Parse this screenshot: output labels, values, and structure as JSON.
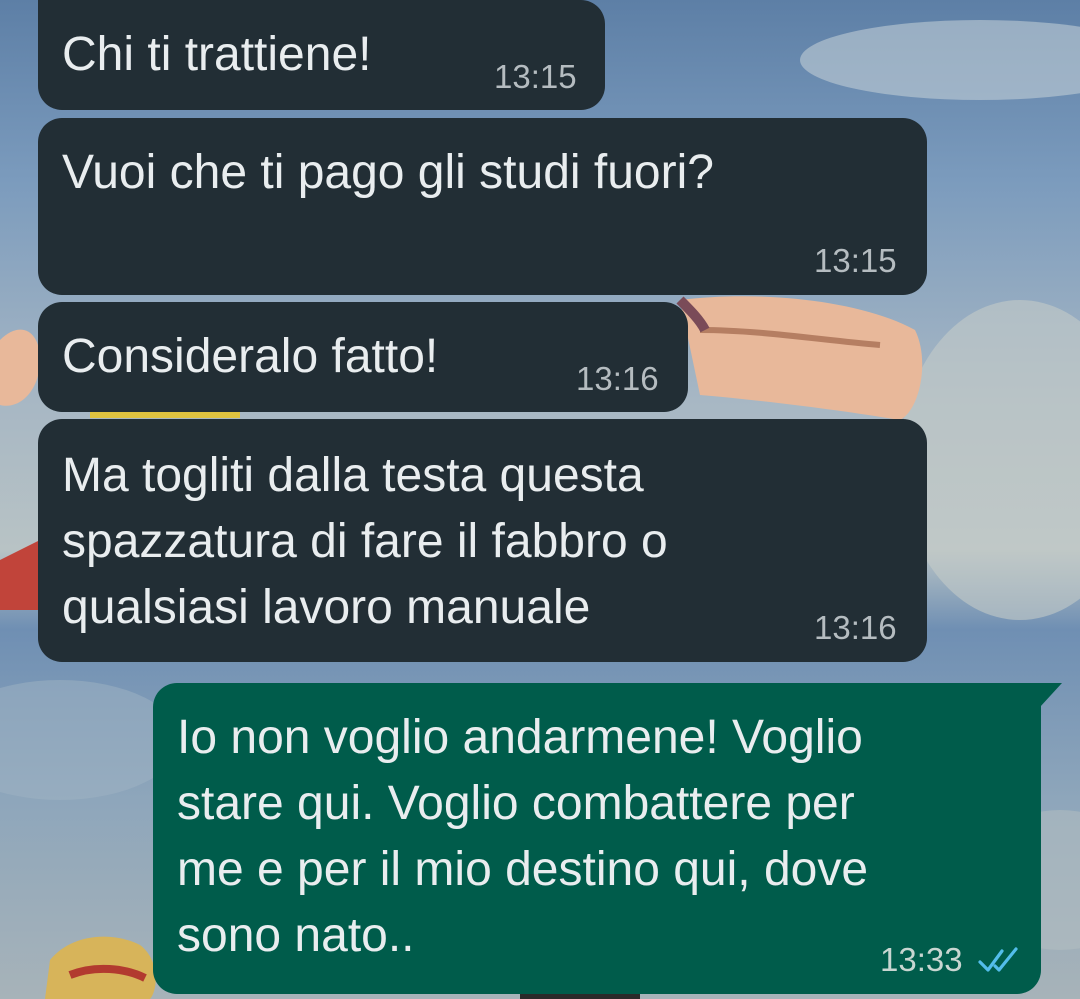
{
  "chat": {
    "messages": [
      {
        "direction": "incoming",
        "text": "Chi ti trattiene!",
        "time": "13:15"
      },
      {
        "direction": "incoming",
        "text": "Vuoi che ti pago gli studi fuori?",
        "time": "13:15"
      },
      {
        "direction": "incoming",
        "text": "Consideralo fatto!",
        "time": "13:16"
      },
      {
        "direction": "incoming",
        "text": "Ma togliti dalla testa questa\nspazzatura di fare il fabbro o\nqualsiasi lavoro manuale",
        "time": "13:16"
      },
      {
        "direction": "outgoing",
        "text": "Io non voglio andarmene! Voglio\nstare qui. Voglio combattere per\nme e per il mio destino qui, dove\nsono nato..",
        "time": "13:33",
        "status": "read"
      }
    ]
  },
  "colors": {
    "incoming_bubble": "#222e35",
    "outgoing_bubble": "#005c4b",
    "text": "#e9edef",
    "read_ticks": "#53bdeb"
  },
  "icons": {
    "read_receipt": "double-check-icon"
  }
}
